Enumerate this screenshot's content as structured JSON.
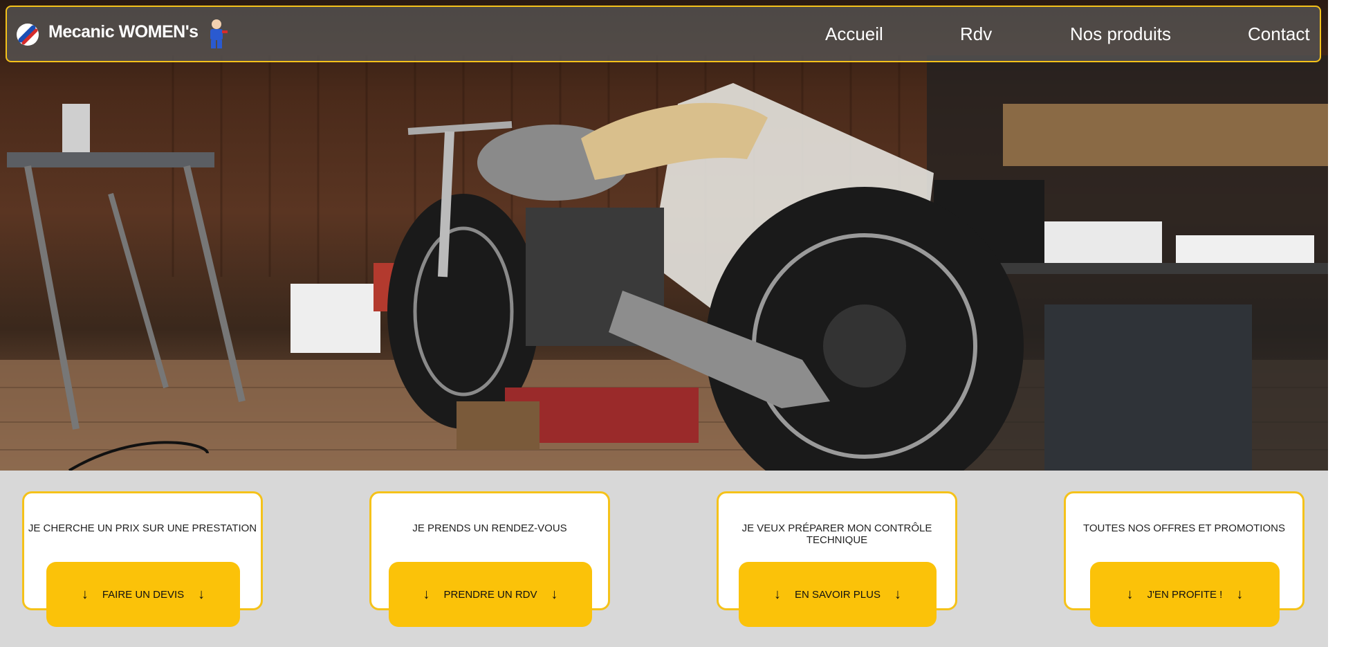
{
  "brand": {
    "name": "Mecanic WOMEN's",
    "logo_icon": "wrench-logo-icon",
    "mascot_icon": "mechanic-mascot-icon"
  },
  "nav": {
    "items": [
      "Accueil",
      "Rdv",
      "Nos produits",
      "Contact"
    ]
  },
  "hero": {
    "image": "garage-motorcycle-photo"
  },
  "cards": [
    {
      "text": "JE CHERCHE UN PRIX SUR UNE PRESTATION",
      "button": "FAIRE UN DEVIS"
    },
    {
      "text": "JE PRENDS UN RENDEZ-VOUS",
      "button": "PRENDRE UN RDV"
    },
    {
      "text": "JE VEUX PRÉPARER MON CONTRÔLE TECHNIQUE",
      "button": "EN SAVOIR PLUS"
    },
    {
      "text": "TOUTES NOS OFFRES ET PROMOTIONS",
      "button": "J'EN PROFITE !"
    }
  ],
  "arrow_glyph": "↓",
  "colors": {
    "accent": "#fbc209",
    "border": "#f5c21a",
    "strip": "#d8d8d8"
  }
}
